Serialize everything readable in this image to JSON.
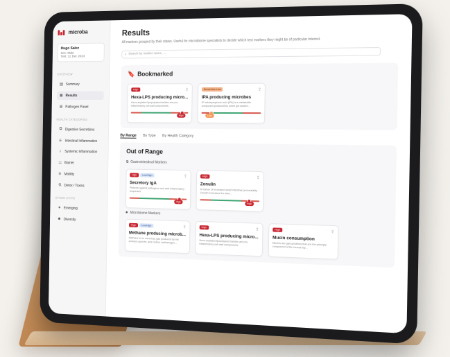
{
  "brand": {
    "name": "microba",
    "color": "#c8242f"
  },
  "patient": {
    "name": "Hugo Salez",
    "sex_label": "Sex",
    "sex": "Male",
    "date_label": "Test",
    "date": "12 Dec 2023"
  },
  "sidebar": {
    "overview_title": "OVERVIEW",
    "items": [
      {
        "label": "Summary",
        "icon": "summary-icon"
      },
      {
        "label": "Results",
        "icon": "results-icon"
      },
      {
        "label": "Pathogen Panel",
        "icon": "pathogen-icon"
      }
    ],
    "health_title": "HEALTH CATEGORIES",
    "health_items": [
      {
        "label": "Digestive Secretions",
        "icon": "digestive-icon"
      },
      {
        "label": "Intestinal Inflammation",
        "icon": "intestinal-icon"
      },
      {
        "label": "Systemic Inflammation",
        "icon": "systemic-icon"
      },
      {
        "label": "Barrier",
        "icon": "barrier-icon"
      },
      {
        "label": "Motility",
        "icon": "motility-icon"
      },
      {
        "label": "Detox / Toxins",
        "icon": "detox-icon"
      }
    ],
    "other_title": "OTHER STATS",
    "other_items": [
      {
        "label": "Emerging",
        "icon": "emerging-icon"
      },
      {
        "label": "Diversity",
        "icon": "diversity-icon"
      }
    ]
  },
  "main": {
    "title": "Results",
    "description": "All markers grouped by their status. Useful for microbiome specialists to decide which test markers they might be of particular interest.",
    "search_placeholder": "Search by marker name, ..."
  },
  "bookmarked": {
    "title": "Bookmarked",
    "cards": [
      {
        "badge": "High",
        "badge_color": "red",
        "title": "Hexa-LPS producing micro...",
        "desc": "Hexa-acylated lipopolysaccharides are pro-inflammatory cell wall components",
        "value": "High",
        "dot_pos": 0.86
      },
      {
        "badge": "Borderline Low",
        "badge_color": "orange",
        "title": "IPA producing microbes",
        "desc": "IP indolepropionic acid (IPA) is a metabolite compound produced by some gut bacteri...",
        "value": "Low",
        "dot_pos": 0.14
      }
    ]
  },
  "tabs": [
    "By Range",
    "By Type",
    "By Health Category"
  ],
  "out_of_range": {
    "title": "Out of Range",
    "gi_title": "Gastrointestinal Markers",
    "gi_cards": [
      {
        "badge": "High",
        "badge2": "Low/High",
        "title": "Secretory IgA",
        "desc": "Protects against pathogens and aids inflammatory responses",
        "value": "High",
        "dot_pos": 0.84
      },
      {
        "badge": "High",
        "badge2": "",
        "title": "Zonulin",
        "desc": "A marker of increased small intestinal permeability. Zonulin increases the alao...",
        "value": "High",
        "dot_pos": 0.8
      }
    ],
    "mb_title": "Microbiome Markers",
    "mb_cards": [
      {
        "badge": "High",
        "badge2": "Low/High",
        "title": "Methane producing microb...",
        "desc": "Methane is an odourless gas produced by the archaea species, and carbon methanogen...",
        "value": "High",
        "dot_pos": 0.86
      },
      {
        "badge": "High",
        "badge2": "",
        "title": "Hexa-LPS producing micro...",
        "desc": "Hexa-acylated lipopolysaccharides are pro-inflammatory cell wall components",
        "value": "High",
        "dot_pos": 0.86
      },
      {
        "badge": "High",
        "badge2": "",
        "title": "Mucin consumption",
        "desc": "Mucins are glycoproteins that are the principle component of the mucus lay...",
        "value": "High",
        "dot_pos": 0.86
      }
    ]
  }
}
